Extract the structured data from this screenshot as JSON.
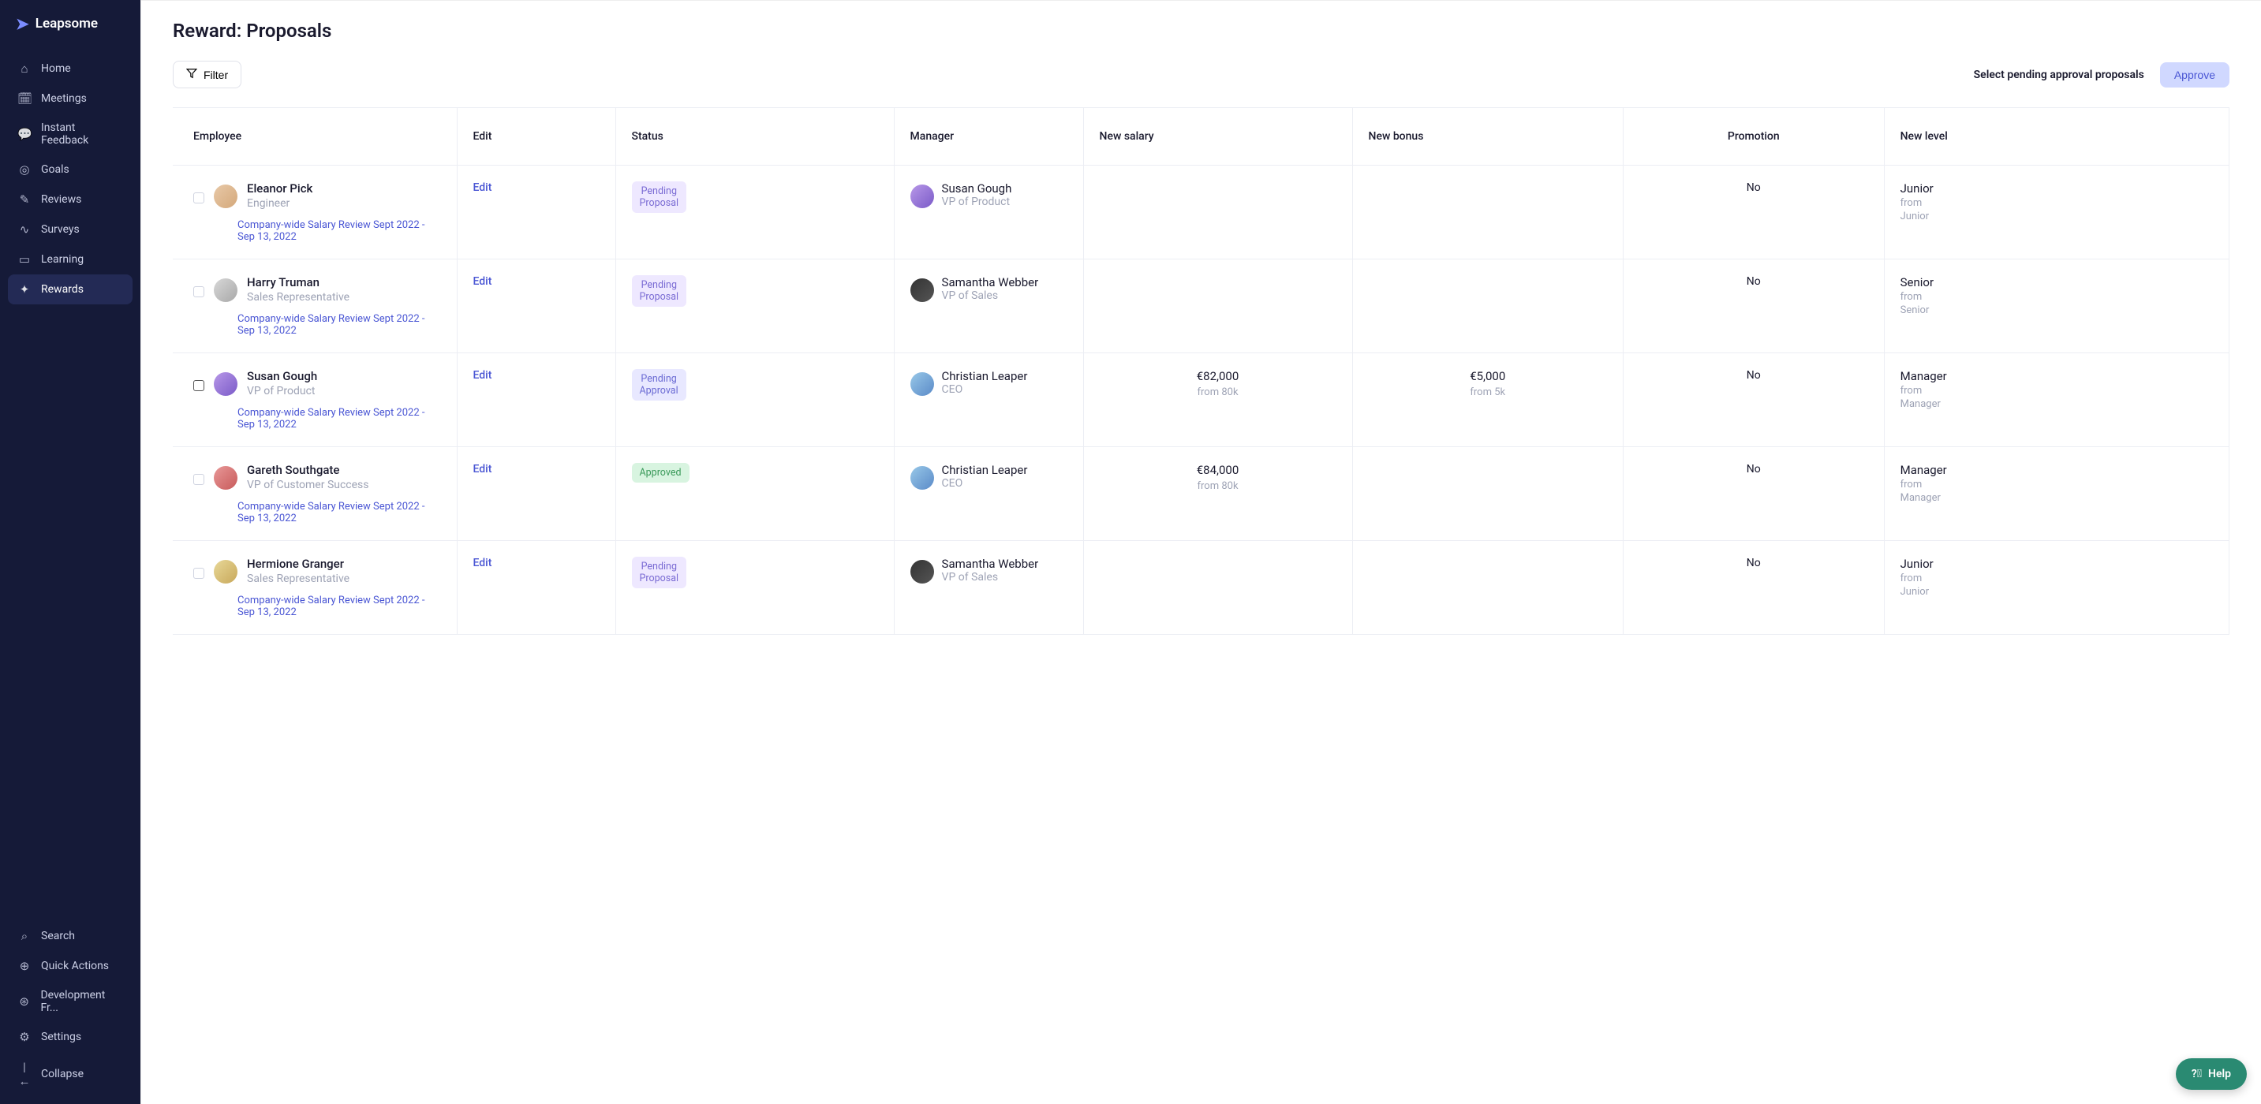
{
  "brand": "Leapsome",
  "sidebar": {
    "items": [
      {
        "label": "Home"
      },
      {
        "label": "Meetings"
      },
      {
        "label": "Instant Feedback"
      },
      {
        "label": "Goals"
      },
      {
        "label": "Reviews"
      },
      {
        "label": "Surveys"
      },
      {
        "label": "Learning"
      },
      {
        "label": "Rewards"
      }
    ],
    "bottom": [
      {
        "label": "Search"
      },
      {
        "label": "Quick Actions"
      },
      {
        "label": "Development Fr..."
      },
      {
        "label": "Settings"
      },
      {
        "label": "Collapse"
      }
    ]
  },
  "page": {
    "title": "Reward: Proposals"
  },
  "toolbar": {
    "filter_label": "Filter",
    "select_pending_label": "Select pending approval proposals",
    "approve_label": "Approve"
  },
  "columns": {
    "employee": "Employee",
    "edit": "Edit",
    "status": "Status",
    "manager": "Manager",
    "new_salary": "New salary",
    "new_bonus": "New bonus",
    "promotion": "Promotion",
    "new_level": "New level"
  },
  "review_link_text": "Company-wide Salary Review Sept 2022 - Sep 13, 2022",
  "edit_text": "Edit",
  "from_text": "from",
  "rows": [
    {
      "employee_name": "Eleanor Pick",
      "employee_role": "Engineer",
      "status_label": "Pending Proposal",
      "status_class": "badge-pending-proposal",
      "manager_name": "Susan Gough",
      "manager_role": "VP of Product",
      "new_salary": "",
      "salary_from": "",
      "new_bonus": "",
      "bonus_from": "",
      "promotion": "No",
      "new_level": "Junior",
      "level_from": "Junior"
    },
    {
      "employee_name": "Harry Truman",
      "employee_role": "Sales Representative",
      "status_label": "Pending Proposal",
      "status_class": "badge-pending-proposal",
      "manager_name": "Samantha Webber",
      "manager_role": "VP of Sales",
      "new_salary": "",
      "salary_from": "",
      "new_bonus": "",
      "bonus_from": "",
      "promotion": "No",
      "new_level": "Senior",
      "level_from": "Senior"
    },
    {
      "employee_name": "Susan Gough",
      "employee_role": "VP of Product",
      "status_label": "Pending Approval",
      "status_class": "badge-pending-approval",
      "manager_name": "Christian Leaper",
      "manager_role": "CEO",
      "new_salary": "€82,000",
      "salary_from": "from 80k",
      "new_bonus": "€5,000",
      "bonus_from": "from 5k",
      "promotion": "No",
      "new_level": "Manager",
      "level_from": "Manager"
    },
    {
      "employee_name": "Gareth Southgate",
      "employee_role": "VP of Customer Success",
      "status_label": "Approved",
      "status_class": "badge-approved",
      "manager_name": "Christian Leaper",
      "manager_role": "CEO",
      "new_salary": "€84,000",
      "salary_from": "from 80k",
      "new_bonus": "",
      "bonus_from": "",
      "promotion": "No",
      "new_level": "Manager",
      "level_from": "Manager"
    },
    {
      "employee_name": "Hermione Granger",
      "employee_role": "Sales Representative",
      "status_label": "Pending Proposal",
      "status_class": "badge-pending-proposal",
      "manager_name": "Samantha Webber",
      "manager_role": "VP of Sales",
      "new_salary": "",
      "salary_from": "",
      "new_bonus": "",
      "bonus_from": "",
      "promotion": "No",
      "new_level": "Junior",
      "level_from": "Junior"
    }
  ],
  "help_label": "Help"
}
